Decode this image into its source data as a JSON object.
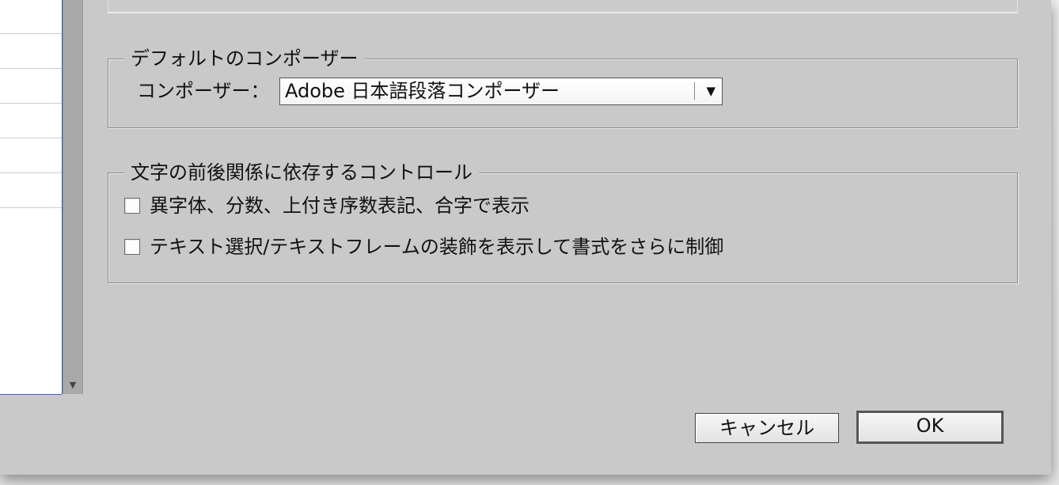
{
  "default_composer": {
    "group_title": "デフォルトのコンポーザー",
    "composer_label": "コンポーザー：",
    "composer_value": "Adobe 日本語段落コンポーザー"
  },
  "context_controls": {
    "group_title": "文字の前後関係に依存するコントロール",
    "options": [
      {
        "label": "異字体、分数、上付き序数表記、合字で表示",
        "checked": false
      },
      {
        "label": "テキスト選択/テキストフレームの装飾を表示して書式をさらに制御",
        "checked": false
      }
    ]
  },
  "buttons": {
    "cancel": "キャンセル",
    "ok": "OK"
  },
  "icons": {
    "dropdown": "triangle-down",
    "scroll_down": "triangle-down"
  }
}
